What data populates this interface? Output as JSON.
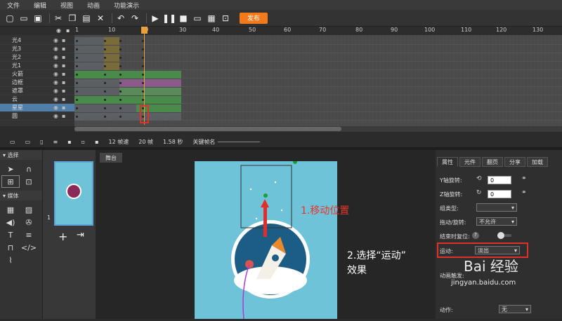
{
  "menu": [
    "文件",
    "编辑",
    "视图",
    "动画",
    "功能演示"
  ],
  "toolbar": {
    "publish": "发布"
  },
  "timeline": {
    "ticks": [
      "1",
      "10",
      "20",
      "30",
      "40",
      "50",
      "60",
      "70",
      "80",
      "90",
      "100",
      "110",
      "120",
      "130"
    ],
    "layers": [
      "光4",
      "光3",
      "光2",
      "光1",
      "火箭",
      "边框",
      "遮罩",
      "云",
      "星星",
      "圆"
    ],
    "selected_layer": "星星"
  },
  "status": {
    "fps": "12 帧速",
    "frames": "20 帧",
    "seconds": "1.58 秒",
    "keyframe_label": "关键帧名"
  },
  "tools": {
    "select_header": "选择",
    "media_header": "媒体"
  },
  "pages": {
    "page_no": "1"
  },
  "stage": {
    "tab": "舞台"
  },
  "annotations": {
    "move": "1.移动位置",
    "choose": "2.选择“运动”",
    "effect": "效果",
    "watermark_brand": "Bai 经验",
    "watermark_url": "jingyan.baidu.com"
  },
  "props": {
    "tabs": [
      "属性",
      "元件",
      "翻页",
      "分享",
      "加载"
    ],
    "y_rotate_label": "Y轴旋转:",
    "y_rotate_value": "0",
    "z_rotate_label": "Z轴旋转:",
    "z_rotate_value": "0",
    "group_label": "组类型:",
    "group_value": "",
    "drag_label": "拖动/旋转:",
    "drag_value": "不允许",
    "reset_label": "结束时复位:",
    "reset_help": "?",
    "motion_label": "运动:",
    "motion_value": "淡出",
    "trigger_label": "动画触发:",
    "action_label": "动作:",
    "action_value": "无"
  },
  "colors": {
    "accent": "#f27a1a",
    "highlight": "#e0302a",
    "stage": "#6fc3d8"
  }
}
